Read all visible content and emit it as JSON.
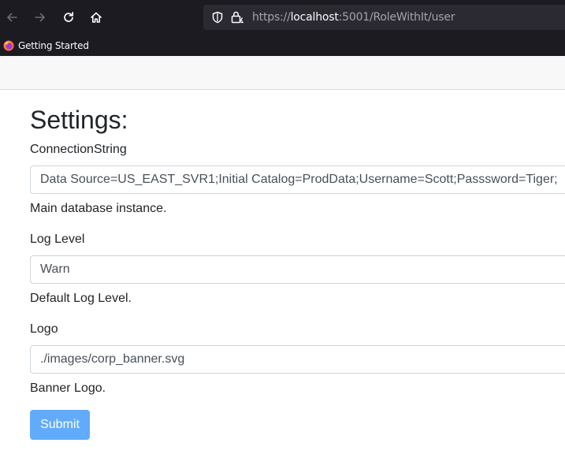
{
  "browser": {
    "url_prefix": "https://",
    "url_host": "localhost",
    "url_rest": ":5001/RoleWithIt/user",
    "bookmarks": [
      {
        "label": "Getting Started",
        "icon": "firefox-icon"
      }
    ]
  },
  "page": {
    "title": "Settings:",
    "fields": [
      {
        "label": "ConnectionString",
        "value": "Data Source=US_EAST_SVR1;Initial Catalog=ProdData;Username=Scott;Passsword=Tiger;",
        "help": "Main database instance."
      },
      {
        "label": "Log Level",
        "value": "Warn",
        "help": "Default Log Level."
      },
      {
        "label": "Logo",
        "value": "./images/corp_banner.svg",
        "help": "Banner Logo."
      }
    ],
    "submit_label": "Submit"
  },
  "colors": {
    "chrome_bg": "#1c1b22",
    "urlbar_bg": "#2b2a33",
    "submit_bg": "#62abfb",
    "navbar_bg": "#f8f8f8"
  }
}
